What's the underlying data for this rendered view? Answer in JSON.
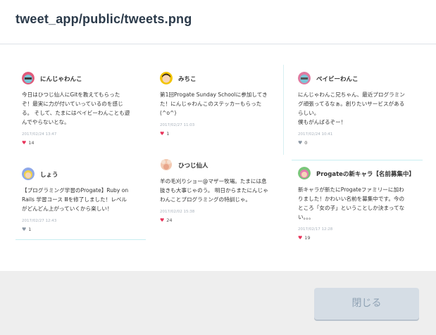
{
  "modal": {
    "title": "tweet_app/public/tweets.png",
    "close_label": "閉じる"
  },
  "tweets": [
    {
      "user": "にんじゃわんこ",
      "text_lines": [
        "今日はひつじ仙人にGitを教えてもらった",
        "ぞ！最実に力が付いていっているのを感じ",
        "る。 そして、たまにはベイビーわんことも遊",
        "んでやらないとな。"
      ],
      "date": "2017/02/24 13:47",
      "likes": "14",
      "liked": true
    },
    {
      "user": "みちこ",
      "text_lines": [
        "第1回Progate Sunday Schoolに参加してき",
        "た！にんじゃわんこのステッカーもらった",
        "(^o^)"
      ],
      "date": "2017/02/27 11:03",
      "likes": "1",
      "liked": true
    },
    {
      "user": "ベイビーわんこ",
      "text_lines": [
        "にんじゃわんこ兄ちゃん、最近プログラミン",
        "グ頑張ってるなぁ。創りたいサービスがある",
        "らしい。",
        "僕もがんばるぞー！"
      ],
      "date": "2017/02/24 10:41",
      "likes": "0",
      "liked": false
    },
    {
      "user": "しょう",
      "text_lines": [
        "【プログラミング学習のProgate】Ruby on",
        "Rails 学習コース Ⅲを修了しました！レベル",
        "がどんどん上がっていくから楽しい！"
      ],
      "date": "2017/02/27 12:43",
      "likes": "1",
      "liked": false
    },
    {
      "user": "ひつじ仙人",
      "text_lines": [
        "羊の毛刈りショー@マザー牧場。たまには息",
        "抜きも大事じゃのう。 明日からまたにんじゃ",
        "わんことプログラミングの特訓じゃ。"
      ],
      "date": "2017/02/02 15:38",
      "likes": "24",
      "liked": true
    },
    {
      "user": "Progateの新キャラ【名前募集中】",
      "text_lines": [
        "新キャラが新たにProgateファミリーに加わ",
        "りました！かわいい名前を募集中です。今の",
        "ところ「女の子」ということしか決まってな",
        "い。。。"
      ],
      "date": "2017/02/17 12:28",
      "likes": "19",
      "liked": true
    }
  ],
  "colors": {
    "like_active": "#e8335a",
    "like_inactive": "#8a96a3",
    "title": "#2b3a4a",
    "footer_bg": "#eeeeee",
    "button_bg": "#d5dde5"
  },
  "icons": {
    "heart": "♥"
  }
}
